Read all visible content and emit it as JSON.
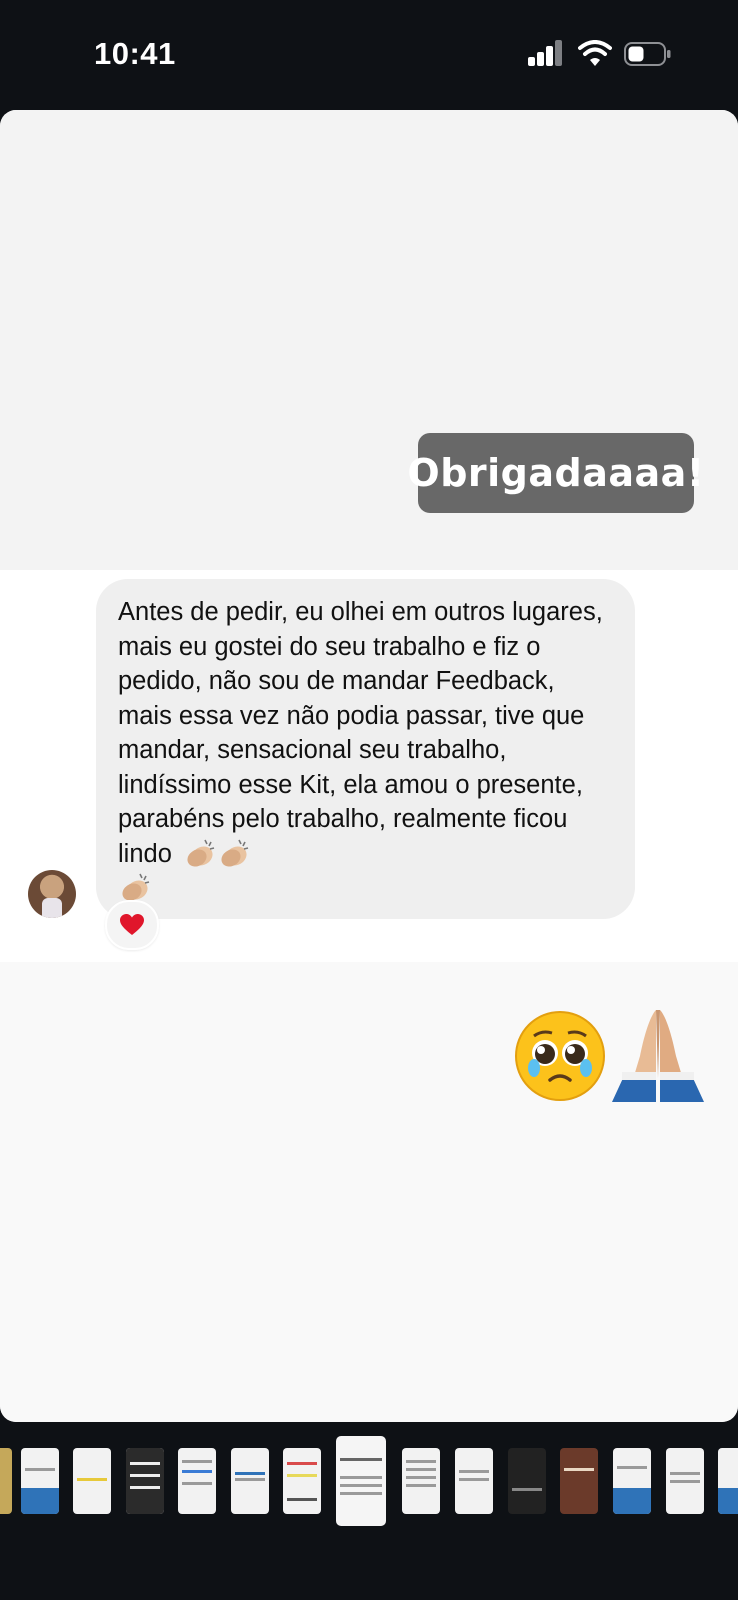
{
  "status_bar": {
    "time": "10:41"
  },
  "story": {
    "sticker_text": "Obrigadaaaa!",
    "dm_message": "Antes de pedir, eu olhei em outros lugares, mais eu gostei do seu trabalho e fiz o pedido, não sou de mandar Feedback, mais essa vez não podia passar, tive que mandar, sensacional seu trabalho, lindíssimo esse Kit, ela amou o presente, parabéns pelo trabalho, realmente ficou lindo",
    "reaction_icon": "heart-icon",
    "emojis": [
      "pleading-face-icon",
      "folded-hands-icon"
    ]
  },
  "thumbnails": {
    "count": 15,
    "active_index": 6,
    "colors": {
      "blue": "#2f73b8",
      "dark": "#2b2b2b",
      "light": "#f2f2f2"
    }
  }
}
